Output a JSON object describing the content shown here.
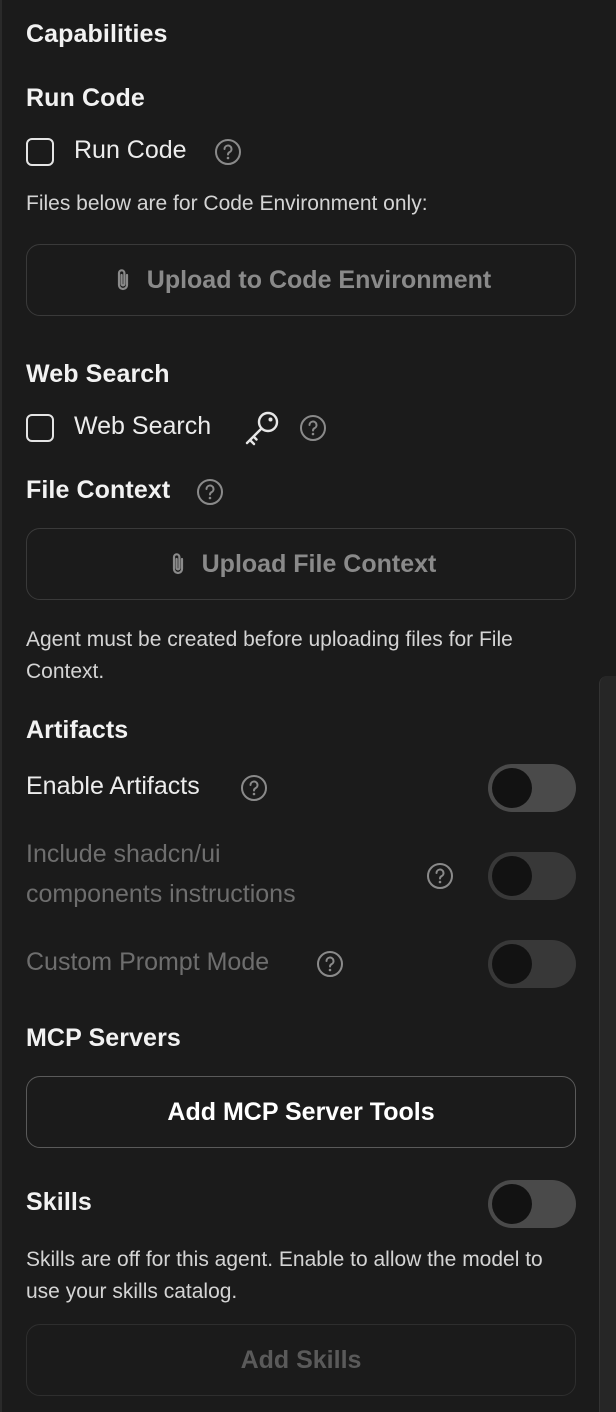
{
  "capabilities": {
    "title": "Capabilities"
  },
  "run_code": {
    "heading": "Run Code",
    "checkbox_label": "Run Code",
    "checked": false,
    "note": "Files below are for Code Environment only:",
    "upload_label": "Upload to Code Environment"
  },
  "web_search": {
    "heading": "Web Search",
    "checkbox_label": "Web Search",
    "checked": false
  },
  "file_context": {
    "heading": "File Context",
    "upload_label": "Upload File Context",
    "note": "Agent must be created before uploading files for File Context."
  },
  "artifacts": {
    "heading": "Artifacts",
    "enable_label": "Enable Artifacts",
    "enable_on": false,
    "shadcn_label_line1": "Include shadcn/ui",
    "shadcn_label_line2": "components instructions",
    "shadcn_on": false,
    "custom_prompt_label": "Custom Prompt Mode",
    "custom_prompt_on": false
  },
  "mcp": {
    "heading": "MCP Servers",
    "add_label": "Add MCP Server Tools"
  },
  "skills": {
    "heading": "Skills",
    "enabled": false,
    "note": "Skills are off for this agent. Enable to allow the model to use your skills catalog.",
    "add_label": "Add Skills"
  },
  "icons": {
    "help": "question-circle-icon",
    "key": "key-icon",
    "attach": "paperclip-icon"
  },
  "colors": {
    "background": "#1b1b1b",
    "text": "#ececec",
    "muted": "#8a8a8a",
    "border": "#3a3a3a",
    "toggle_off": "#4a4a4a"
  }
}
